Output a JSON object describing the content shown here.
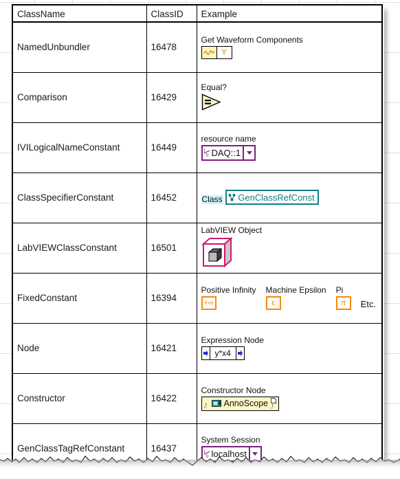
{
  "table": {
    "columns": [
      "ClassName",
      "ClassID",
      "Example"
    ],
    "rows": [
      {
        "class_name": "NamedUnbundler",
        "class_id": "16478",
        "example_label": "Get Waveform Components",
        "example_widget": "unbundler",
        "widget_text": "Y"
      },
      {
        "class_name": "Comparison",
        "class_id": "16429",
        "example_label": "Equal?",
        "example_widget": "comparison",
        "widget_text": "="
      },
      {
        "class_name": "IVILogicalNameConstant",
        "class_id": "16449",
        "example_label": "resource name",
        "example_widget": "io-control",
        "widget_text": "DAQ::1"
      },
      {
        "class_name": "ClassSpecifierConstant",
        "class_id": "16452",
        "example_label": "Class",
        "example_widget": "class-constant",
        "widget_text": "GenClassRefConst"
      },
      {
        "class_name": "LabVIEWClassConstant",
        "class_id": "16501",
        "example_label": "LabVIEW Object",
        "example_widget": "object-cube",
        "widget_text": ""
      },
      {
        "class_name": "FixedConstant",
        "class_id": "16394",
        "example_label": "",
        "example_widget": "fixed-constants",
        "widget_text": ""
      },
      {
        "class_name": "Node",
        "class_id": "16421",
        "example_label": "Expression Node",
        "example_widget": "expression-node",
        "widget_text": "y*x4"
      },
      {
        "class_name": "Constructor",
        "class_id": "16422",
        "example_label": "Constructor Node",
        "example_widget": "constructor-node",
        "widget_text": "AnnoScope"
      },
      {
        "class_name": "GenClassTagRefConstant",
        "class_id": "16437",
        "example_label": "System Session",
        "example_widget": "io-control",
        "widget_text": "localhost"
      }
    ]
  },
  "fixed_constants": {
    "items": [
      {
        "label": "Positive Infinity",
        "glyph": "+∞"
      },
      {
        "label": "Machine Epsilon",
        "glyph": "ε"
      },
      {
        "label": "Pi",
        "glyph": "π"
      }
    ],
    "etc": "Etc."
  },
  "icons": {
    "waveform": "waveform-icon",
    "y_terminal": "y-terminal-icon",
    "equal_arrow": "equal-comparison-icon",
    "io_refnum": "io-refnum-icon",
    "dropdown_arrow": "chevron-down-icon",
    "class_ref": "class-reference-icon",
    "labview_object": "labview-object-cube-icon",
    "expression_terminal": "expression-terminal-icon",
    "constructor_glyph": "constructor-icon",
    "constructor_error_in": "error-terminal-icon",
    "constructor_page": "page-icon"
  },
  "colors": {
    "grid_line": "#bec8d7",
    "table_border": "#000000",
    "text": "#1a1a1a",
    "purple_control": "#7b1f7b",
    "teal_class": "#0f7f84",
    "orange_constant": "#f58a0b",
    "magenta_cube": "#cc1a6e",
    "yellow_node": "#fbf6c6",
    "blue_terminal": "#1e2fd6",
    "highlight_cyan": "#ccf2fb"
  }
}
